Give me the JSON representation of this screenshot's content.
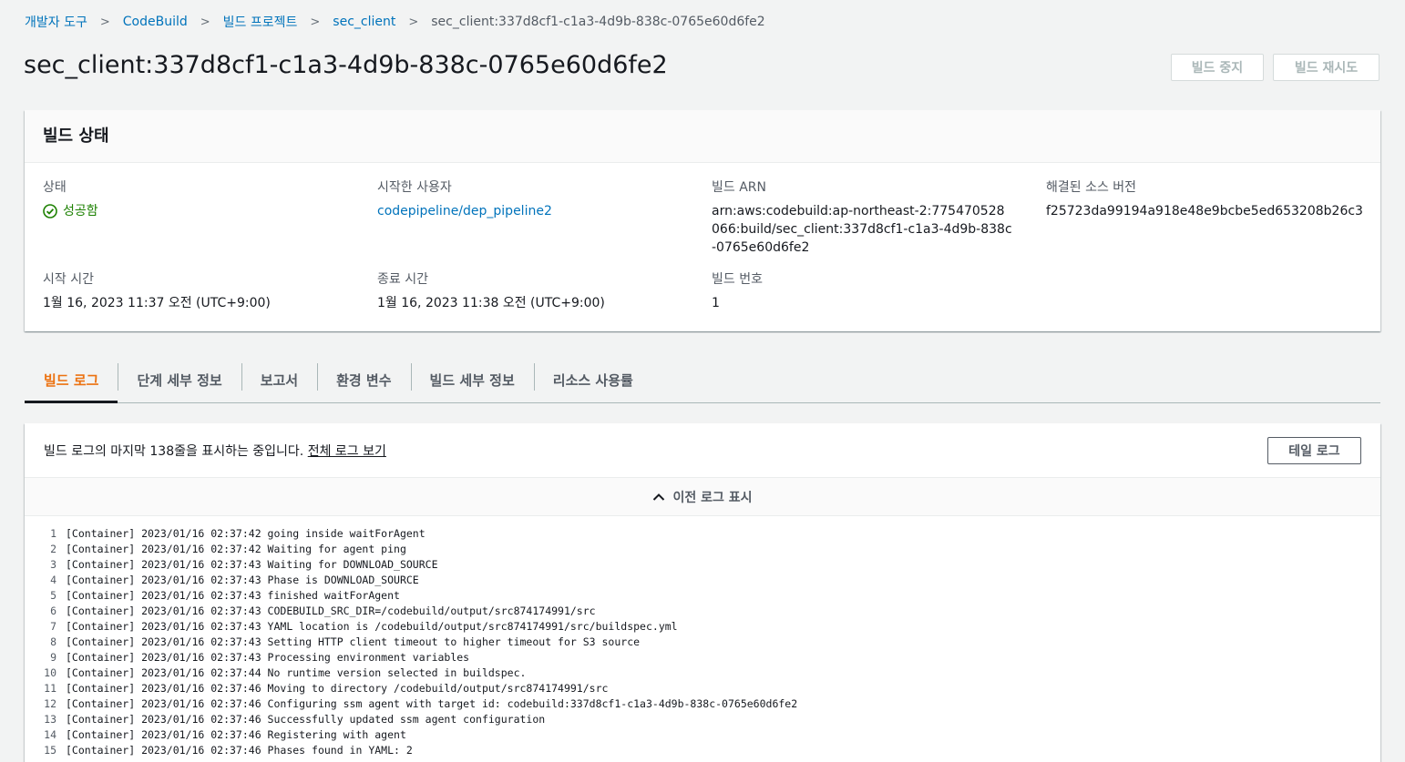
{
  "breadcrumb": [
    {
      "label": "개발자 도구"
    },
    {
      "label": "CodeBuild"
    },
    {
      "label": "빌드 프로젝트"
    },
    {
      "label": "sec_client"
    }
  ],
  "breadcrumb_current": "sec_client:337d8cf1-c1a3-4d9b-838c-0765e60d6fe2",
  "page_title": "sec_client:337d8cf1-c1a3-4d9b-838c-0765e60d6fe2",
  "actions": {
    "stop_label": "빌드 중지",
    "retry_label": "빌드 재시도"
  },
  "status_panel": {
    "title": "빌드 상태",
    "status": {
      "label": "상태",
      "value": "성공함"
    },
    "initiator": {
      "label": "시작한 사용자",
      "value": "codepipeline/dep_pipeline2"
    },
    "arn": {
      "label": "빌드 ARN",
      "value": "arn:aws:codebuild:ap-northeast-2:775470528066:build/sec_client:337d8cf1-c1a3-4d9b-838c-0765e60d6fe2"
    },
    "source_version": {
      "label": "해결된 소스 버전",
      "value": "f25723da99194a918e48e9bcbe5ed653208b26c3"
    },
    "start_time": {
      "label": "시작 시간",
      "value": "1월 16, 2023 11:37 오전 (UTC+9:00)"
    },
    "end_time": {
      "label": "종료 시간",
      "value": "1월 16, 2023 11:38 오전 (UTC+9:00)"
    },
    "build_number": {
      "label": "빌드 번호",
      "value": "1"
    }
  },
  "tabs": [
    {
      "label": "빌드 로그",
      "active": true
    },
    {
      "label": "단계 세부 정보"
    },
    {
      "label": "보고서"
    },
    {
      "label": "환경 변수"
    },
    {
      "label": "빌드 세부 정보"
    },
    {
      "label": "리소스 사용률"
    }
  ],
  "log_panel": {
    "summary_text": "빌드 로그의 마지막 138줄을 표시하는 중입니다. ",
    "full_log_link": "전체 로그 보기",
    "tail_button": "테일 로그",
    "prev_log_label": "이전 로그 표시",
    "lines": [
      {
        "n": "1",
        "text": "[Container] 2023/01/16 02:37:42 going inside waitForAgent"
      },
      {
        "n": "2",
        "text": "[Container] 2023/01/16 02:37:42 Waiting for agent ping"
      },
      {
        "n": "3",
        "text": "[Container] 2023/01/16 02:37:43 Waiting for DOWNLOAD_SOURCE"
      },
      {
        "n": "4",
        "text": "[Container] 2023/01/16 02:37:43 Phase is DOWNLOAD_SOURCE"
      },
      {
        "n": "5",
        "text": "[Container] 2023/01/16 02:37:43 finished waitForAgent"
      },
      {
        "n": "6",
        "text": "[Container] 2023/01/16 02:37:43 CODEBUILD_SRC_DIR=/codebuild/output/src874174991/src"
      },
      {
        "n": "7",
        "text": "[Container] 2023/01/16 02:37:43 YAML location is /codebuild/output/src874174991/src/buildspec.yml"
      },
      {
        "n": "8",
        "text": "[Container] 2023/01/16 02:37:43 Setting HTTP client timeout to higher timeout for S3 source"
      },
      {
        "n": "9",
        "text": "[Container] 2023/01/16 02:37:43 Processing environment variables"
      },
      {
        "n": "10",
        "text": "[Container] 2023/01/16 02:37:44 No runtime version selected in buildspec."
      },
      {
        "n": "11",
        "text": "[Container] 2023/01/16 02:37:46 Moving to directory /codebuild/output/src874174991/src"
      },
      {
        "n": "12",
        "text": "[Container] 2023/01/16 02:37:46 Configuring ssm agent with target id: codebuild:337d8cf1-c1a3-4d9b-838c-0765e60d6fe2"
      },
      {
        "n": "13",
        "text": "[Container] 2023/01/16 02:37:46 Successfully updated ssm agent configuration"
      },
      {
        "n": "14",
        "text": "[Container] 2023/01/16 02:37:46 Registering with agent"
      },
      {
        "n": "15",
        "text": "[Container] 2023/01/16 02:37:46 Phases found in YAML: 2"
      }
    ]
  },
  "colors": {
    "link": "#0073bb",
    "success": "#1d8102",
    "active_tab": "#ec7211"
  }
}
